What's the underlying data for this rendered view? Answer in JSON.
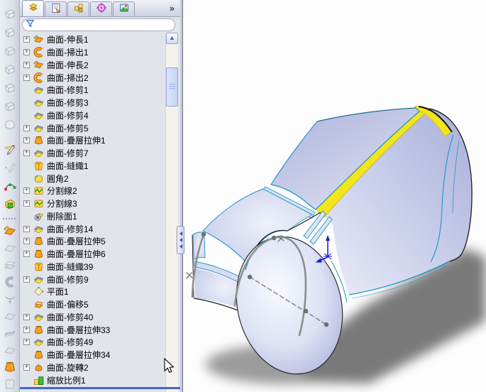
{
  "panel": {
    "tabs": [
      {
        "name": "featuremanager-tab",
        "icon": "featuremanager",
        "active": true
      },
      {
        "name": "propertymanager-tab",
        "icon": "propertymanager",
        "active": false
      },
      {
        "name": "configurationmanager-tab",
        "icon": "configurationmanager",
        "active": false
      },
      {
        "name": "dimxpertmanager-tab",
        "icon": "dimxpertmanager",
        "active": false
      },
      {
        "name": "displaymanager-tab",
        "icon": "displaymanager",
        "active": false
      }
    ],
    "overflow_chevron": "»",
    "filter": {
      "value": "",
      "placeholder": "",
      "icon": "filter-funnel"
    },
    "tree": {
      "items": [
        {
          "label": "曲面-伸長1",
          "icon": "surface-extrude",
          "expandable": true
        },
        {
          "label": "曲面-掃出1",
          "icon": "surface-sweep",
          "expandable": true
        },
        {
          "label": "曲面-伸長2",
          "icon": "surface-extrude",
          "expandable": true
        },
        {
          "label": "曲面-掃出2",
          "icon": "surface-sweep",
          "expandable": true
        },
        {
          "label": "曲面-修剪1",
          "icon": "surface-trim",
          "expandable": false
        },
        {
          "label": "曲面-修剪3",
          "icon": "surface-trim",
          "expandable": false
        },
        {
          "label": "曲面-修剪4",
          "icon": "surface-trim",
          "expandable": false
        },
        {
          "label": "曲面-修剪5",
          "icon": "surface-trim",
          "expandable": true
        },
        {
          "label": "曲面-疊層拉伸1",
          "icon": "surface-loft",
          "expandable": true
        },
        {
          "label": "曲面-修剪7",
          "icon": "surface-trim",
          "expandable": true
        },
        {
          "label": "曲面-縫織1",
          "icon": "surface-knit",
          "expandable": false
        },
        {
          "label": "圓角2",
          "icon": "fillet",
          "expandable": false
        },
        {
          "label": "分割線2",
          "icon": "split-line",
          "expandable": true
        },
        {
          "label": "分割線3",
          "icon": "split-line",
          "expandable": true
        },
        {
          "label": "刪除面1",
          "icon": "delete-face",
          "expandable": false
        },
        {
          "label": "曲面-修剪14",
          "icon": "surface-trim",
          "expandable": true
        },
        {
          "label": "曲面-疊層拉伸5",
          "icon": "surface-loft",
          "expandable": true
        },
        {
          "label": "曲面-疊層拉伸6",
          "icon": "surface-loft",
          "expandable": true
        },
        {
          "label": "曲面-縫織39",
          "icon": "surface-knit",
          "expandable": false
        },
        {
          "label": "曲面-修剪9",
          "icon": "surface-trim",
          "expandable": true
        },
        {
          "label": "平面1",
          "icon": "plane",
          "expandable": false
        },
        {
          "label": "曲面-偏移5",
          "icon": "surface-offset",
          "expandable": false
        },
        {
          "label": "曲面-修剪40",
          "icon": "surface-trim",
          "expandable": true
        },
        {
          "label": "曲面-疊層拉伸33",
          "icon": "surface-loft",
          "expandable": true
        },
        {
          "label": "曲面-修剪49",
          "icon": "surface-trim",
          "expandable": true
        },
        {
          "label": "曲面-疊層拉伸34",
          "icon": "surface-loft",
          "expandable": false
        },
        {
          "label": "曲面-旋轉2",
          "icon": "surface-revolve",
          "expandable": true
        },
        {
          "label": "縮放比例1",
          "icon": "scale",
          "expandable": false
        }
      ]
    },
    "expand_glyph": "+"
  },
  "left_toolbar": {
    "items": [
      {
        "name": "view-cube-1",
        "icon": "cube",
        "enabled": false
      },
      {
        "name": "view-cube-2",
        "icon": "cube",
        "enabled": false
      },
      {
        "name": "view-cube-3",
        "icon": "cube",
        "enabled": false
      },
      {
        "name": "view-cube-4",
        "icon": "cube",
        "enabled": false
      },
      {
        "name": "view-cube-5",
        "icon": "cube",
        "enabled": false
      },
      {
        "name": "view-cube-6",
        "icon": "cube",
        "enabled": false
      },
      {
        "name": "view-cube-round",
        "icon": "cube-round",
        "enabled": false
      },
      {
        "name": "sketch",
        "icon": "sketch",
        "enabled": true,
        "gap": true
      },
      {
        "name": "3d-sketch",
        "icon": "sketch-3d",
        "enabled": false
      },
      {
        "name": "curve-through-points",
        "icon": "curve-ref",
        "enabled": true
      },
      {
        "name": "solid-tool",
        "icon": "solid-box",
        "enabled": true
      },
      {
        "name": "separator",
        "icon": "separator"
      },
      {
        "name": "extruded-surface",
        "icon": "surf-extrude",
        "enabled": true
      },
      {
        "name": "planar-surface",
        "icon": "surf-sheet",
        "enabled": false
      },
      {
        "name": "offset-surface",
        "icon": "surf-offset",
        "enabled": false
      },
      {
        "name": "swept-surface",
        "icon": "surf-sweep",
        "enabled": false
      },
      {
        "name": "boundary-surface",
        "icon": "surf-boundary",
        "enabled": false
      },
      {
        "name": "filled-surface",
        "icon": "surf-sheet",
        "enabled": false
      },
      {
        "name": "freeform-surface",
        "icon": "surf-freeform",
        "enabled": false
      },
      {
        "name": "radiate-surface",
        "icon": "surf-sheet",
        "enabled": false
      },
      {
        "name": "lofted-surface",
        "icon": "surf-loft",
        "enabled": true
      },
      {
        "name": "knit-surface",
        "icon": "surf-knit-gray",
        "enabled": false
      }
    ]
  },
  "viewport": {
    "model_colors": {
      "body": "#c3c9e8",
      "body_light": "#e9ebf7",
      "accent_stripe": "#f2e41d",
      "edge_blue": "#1b95c5",
      "silhouette": "#1c1c22",
      "sketch_gray": "#8e8e8e",
      "origin_triad": "#1616d8",
      "shadow": "#6b6b6b"
    }
  },
  "rollback_bar": {
    "color": "#3f6bc6"
  }
}
